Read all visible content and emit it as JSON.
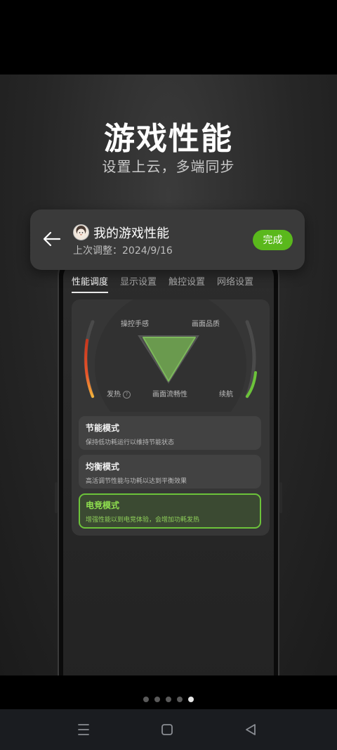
{
  "hero": {
    "title": "游戏性能",
    "subtitle": "设置上云，多端同步"
  },
  "card": {
    "title": "我的游戏性能",
    "subtitle": "上次调整：2024/9/16",
    "done_label": "完成"
  },
  "tabs": [
    {
      "label": "性能调度",
      "active": true
    },
    {
      "label": "显示设置",
      "active": false
    },
    {
      "label": "触控设置",
      "active": false
    },
    {
      "label": "网络设置",
      "active": false
    }
  ],
  "gauge": {
    "top_left": "操控手感",
    "top_right": "画面品质",
    "bottom_left": "发热",
    "bottom_center": "画面流畅性",
    "bottom_right": "续航",
    "help_symbol": "?",
    "heat_color": "#e8552a",
    "battery_color": "#6cc33a"
  },
  "modes": [
    {
      "title": "节能模式",
      "desc": "保持低功耗运行以维持节能状态",
      "active": false
    },
    {
      "title": "均衡模式",
      "desc": "高活调节性能与功耗以达到平衡效果",
      "active": false
    },
    {
      "title": "电竞模式",
      "desc": "增强性能以到电竞体验，会增加功耗发热",
      "active": true
    }
  ],
  "pager": {
    "count": 5,
    "active_index": 4
  },
  "nav": {
    "menu_icon": "menu-icon",
    "home_icon": "home-icon",
    "back_icon": "back-triangle-icon"
  },
  "colors": {
    "accent": "#5ab81c",
    "active_mode_border": "#6cc33a"
  }
}
